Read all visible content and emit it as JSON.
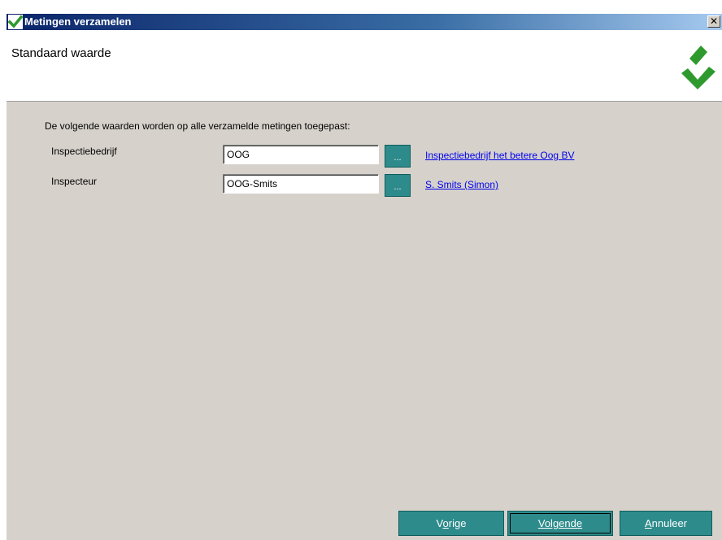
{
  "window": {
    "title": "Metingen verzamelen",
    "close_label": "✕"
  },
  "header": {
    "title": "Standaard waarde"
  },
  "content": {
    "intro": "De volgende waarden worden op alle verzamelde metingen toegepast:",
    "fields": [
      {
        "label": "Inspectiebedrijf",
        "value": "OOG",
        "lookup_label": "...",
        "link": "Inspectiebedrijf het betere Oog BV"
      },
      {
        "label": "Inspecteur",
        "value": "OOG-Smits",
        "lookup_label": "...",
        "link": "S. Smits (Simon)"
      }
    ]
  },
  "footer": {
    "back": {
      "mnemonic": "o",
      "pre": "V",
      "post": "rige"
    },
    "next": {
      "mnemonic": "",
      "pre": "Volgende",
      "post": ""
    },
    "cancel": {
      "mnemonic": "A",
      "pre": "",
      "post": "nnuleer"
    }
  },
  "colors": {
    "accent_teal": "#2e8b8b",
    "logo_green": "#2e9a2e",
    "link_blue": "#0000ee",
    "window_bg": "#d6d2cb"
  },
  "icons": {
    "app": "checkmark-icon",
    "logo": "checkmark-logo-icon",
    "close": "close-icon"
  }
}
